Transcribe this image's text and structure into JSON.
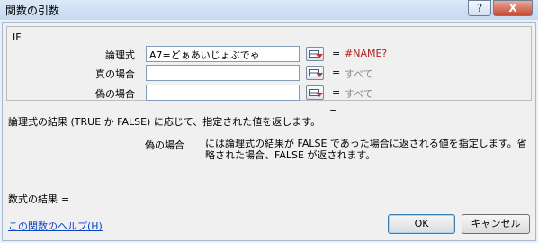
{
  "window": {
    "title": "関数の引数",
    "help_glyph": "?",
    "close_glyph": "X"
  },
  "function": {
    "name": "IF",
    "args": [
      {
        "label": "論理式",
        "value": "A7=どぁあいじょぶでゃ",
        "equals": "=",
        "result": "#NAME?"
      },
      {
        "label": "真の場合",
        "value": "",
        "equals": "=",
        "result": "すべて"
      },
      {
        "label": "偽の場合",
        "value": "",
        "equals": "=",
        "result": "すべて"
      }
    ],
    "overall_equals": "=",
    "description": "論理式の結果 (TRUE か FALSE) に応じて、指定された値を返します。",
    "current_arg_name": "偽の場合",
    "current_arg_description": "には論理式の結果が FALSE であった場合に返される値を指定します。省略された場合、FALSE が返されます。"
  },
  "formula_result": {
    "label": "数式の結果",
    "equals": "="
  },
  "footer": {
    "help_link": "この関数のヘルプ(H)",
    "ok_label": "OK",
    "cancel_label": "キャンセル"
  },
  "colors": {
    "error": "#b31b1b",
    "muted": "#8a8a8a",
    "link": "#0a45c7"
  }
}
